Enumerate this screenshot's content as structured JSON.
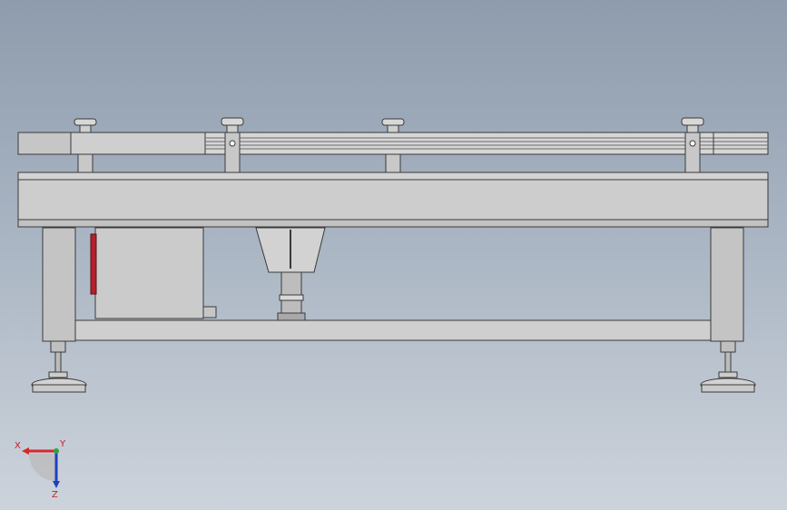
{
  "view": {
    "colors": {
      "background_top": "#8e9cad",
      "background_bottom": "#cdd3db",
      "part_fill": "#c9c9c9",
      "part_edge": "#3a3a3a",
      "highlight_red": "#b5202a"
    }
  },
  "triad": {
    "x_label": "X",
    "y_label": "Y",
    "z_label": "Z",
    "x_color": "#d22b2b",
    "y_color": "#2ea043",
    "z_color": "#1f3fbf"
  }
}
